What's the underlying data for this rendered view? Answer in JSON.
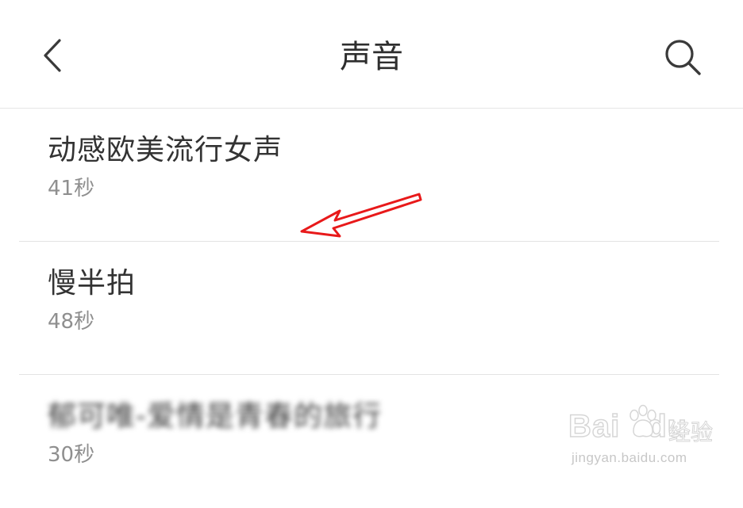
{
  "header": {
    "title": "声音",
    "back_icon": "chevron-left-icon",
    "search_icon": "search-icon"
  },
  "sounds": [
    {
      "name": "动感欧美流行女声",
      "duration": "41秒"
    },
    {
      "name": "慢半拍",
      "duration": "48秒"
    },
    {
      "name": "郁可唯-爱情是青春的旅行",
      "duration": "30秒"
    }
  ],
  "annotation": {
    "arrow_color": "#e8191a"
  },
  "watermark": {
    "brand_prefix": "Bai",
    "brand_suffix": "du",
    "brand_cn": "经验",
    "url": "jingyan.baidu.com"
  },
  "colors": {
    "title": "#2e2e2e",
    "item_name": "#333333",
    "item_duration": "#8f8f8f",
    "divider": "#e3e3e3"
  }
}
